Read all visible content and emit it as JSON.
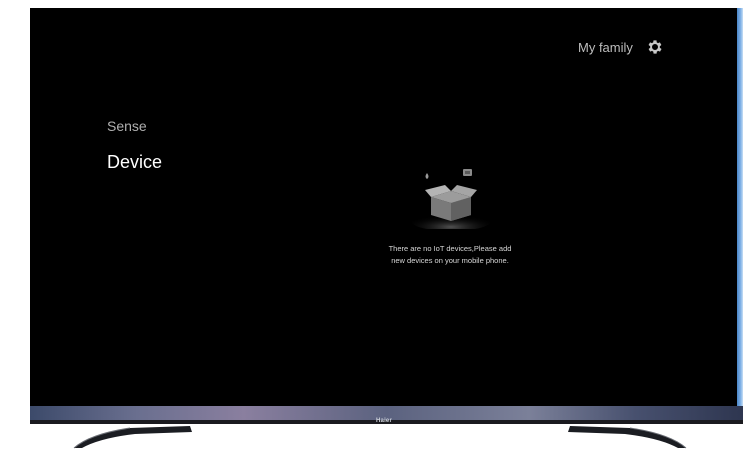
{
  "header": {
    "family_label": "My family",
    "settings_icon": "gear-icon"
  },
  "sidebar": {
    "items": [
      {
        "label": "Sense",
        "selected": false
      },
      {
        "label": "Device",
        "selected": true
      }
    ]
  },
  "main": {
    "empty_icon": "empty-box-icon",
    "empty_message_line1": "There are no IoT devices,Please add",
    "empty_message_line2": "new devices on your mobile phone."
  },
  "tv": {
    "brand": "Haier"
  },
  "colors": {
    "screen_background": "#000000",
    "selected_text": "#ffffff",
    "muted_text": "#b0b0b0"
  }
}
